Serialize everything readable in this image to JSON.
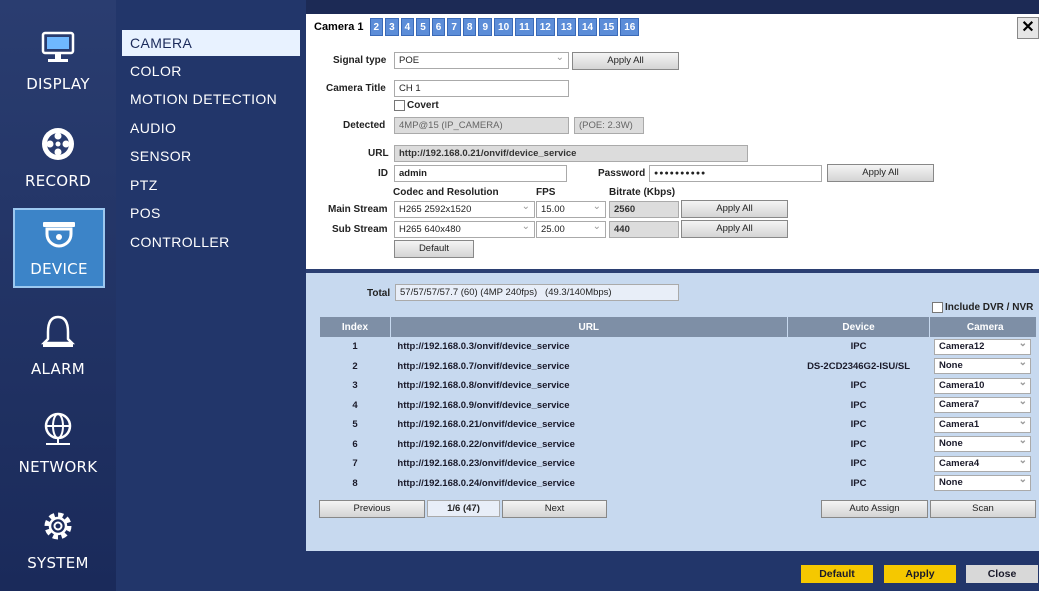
{
  "nav": {
    "display": "DISPLAY",
    "record": "RECORD",
    "device": "DEVICE",
    "alarm": "ALARM",
    "network": "NETWORK",
    "system": "SYSTEM"
  },
  "submenu": [
    "CAMERA",
    "COLOR",
    "MOTION DETECTION",
    "AUDIO",
    "SENSOR",
    "PTZ",
    "POS",
    "CONTROLLER"
  ],
  "tabs": [
    "Camera 1",
    "2",
    "3",
    "4",
    "5",
    "6",
    "7",
    "8",
    "9",
    "10",
    "11",
    "12",
    "13",
    "14",
    "15",
    "16"
  ],
  "close_label": "✕",
  "form": {
    "signal_type_label": "Signal type",
    "signal_type_value": "POE",
    "apply_all": "Apply All",
    "camera_title_label": "Camera Title",
    "camera_title_value": "CH 1",
    "covert_label": "Covert",
    "detected_label": "Detected",
    "detected_value": "4MP@15 (IP_CAMERA)",
    "poe_value": "(POE: 2.3W)",
    "url_label": "URL",
    "url_value": "http://192.168.0.21/onvif/device_service",
    "id_label": "ID",
    "id_value": "admin",
    "password_label": "Password",
    "password_value": "●●●●●●●●●●",
    "codec_header": "Codec and Resolution",
    "fps_header": "FPS",
    "bitrate_header": "Bitrate (Kbps)",
    "main_stream_label": "Main Stream",
    "main_codec": "H265 2592x1520",
    "main_fps": "15.00",
    "main_bitrate": "2560",
    "sub_stream_label": "Sub Stream",
    "sub_codec": "H265 640x480",
    "sub_fps": "25.00",
    "sub_bitrate": "440",
    "default_label": "Default"
  },
  "list": {
    "total_label": "Total",
    "total_value": "57/57/57/57.7 (60) (4MP 240fps)   (49.3/140Mbps)",
    "include_label": "Include DVR / NVR",
    "headers": [
      "Index",
      "URL",
      "Device",
      "Camera"
    ],
    "rows": [
      {
        "index": "1",
        "url": "http://192.168.0.3/onvif/device_service",
        "device": "IPC",
        "camera": "Camera12"
      },
      {
        "index": "2",
        "url": "http://192.168.0.7/onvif/device_service",
        "device": "DS-2CD2346G2-ISU/SL",
        "camera": "None"
      },
      {
        "index": "3",
        "url": "http://192.168.0.8/onvif/device_service",
        "device": "IPC",
        "camera": "Camera10"
      },
      {
        "index": "4",
        "url": "http://192.168.0.9/onvif/device_service",
        "device": "IPC",
        "camera": "Camera7"
      },
      {
        "index": "5",
        "url": "http://192.168.0.21/onvif/device_service",
        "device": "IPC",
        "camera": "Camera1"
      },
      {
        "index": "6",
        "url": "http://192.168.0.22/onvif/device_service",
        "device": "IPC",
        "camera": "None"
      },
      {
        "index": "7",
        "url": "http://192.168.0.23/onvif/device_service",
        "device": "IPC",
        "camera": "Camera4"
      },
      {
        "index": "8",
        "url": "http://192.168.0.24/onvif/device_service",
        "device": "IPC",
        "camera": "None"
      }
    ],
    "previous": "Previous",
    "page": "1/6 (47)",
    "next": "Next",
    "auto_assign": "Auto Assign",
    "scan": "Scan"
  },
  "footer": {
    "default": "Default",
    "apply": "Apply",
    "close": "Close"
  },
  "colors": {
    "accent": "#3c84c8",
    "footer_button": "#f5c800",
    "tab_blue": "#5c8dd8"
  }
}
